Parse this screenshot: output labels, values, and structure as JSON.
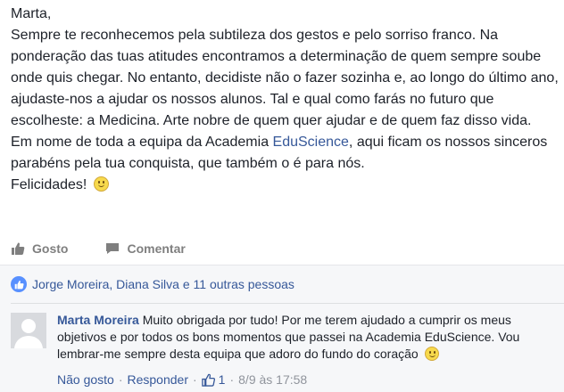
{
  "post": {
    "greeting": "Marta,",
    "text_1": "Sempre te reconhecemos pela subtileza dos gestos e pelo sorriso franco. Na ponderação das tuas atitudes encontramos a determinação de quem sempre soube onde quis chegar. No entanto, decidiste não o fazer sozinha e, ao longo do último ano, ajudaste-nos a ajudar os nossos alunos. Tal e qual como farás no futuro que escolheste: a Medicina. Arte nobre de quem quer ajudar e de quem faz disso vida.",
    "text_2_before": "Em nome de toda a equipa da Academia ",
    "text_2_link": "EduScience",
    "text_2_after": ", aqui ficam os nossos sinceros parabéns pela tua conquista, que também o é para nós.",
    "closing": "Felicidades!"
  },
  "actions": {
    "like_label": "Gosto",
    "comment_label": "Comentar"
  },
  "likes": {
    "summary": "Jorge Moreira, Diana Silva e 11 outras pessoas"
  },
  "comment": {
    "author": "Marta Moreira",
    "text": "Muito obrigada por tudo! Por me terem ajudado a cumprir os meus objetivos e por todos os bons momentos que passei na Academia EduScience. Vou lembrar-me sempre desta equipa que adoro do fundo do coração",
    "unlike_label": "Não gosto",
    "reply_label": "Responder",
    "like_count": "1",
    "timestamp": "8/9 às 17:58"
  },
  "colors": {
    "link": "#365899",
    "like_badge": "#5890ff",
    "muted": "#90949c"
  }
}
